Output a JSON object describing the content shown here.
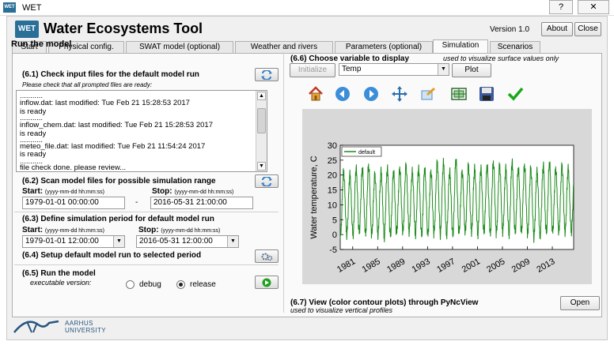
{
  "window": {
    "logo_text": "WET",
    "title": "WET",
    "help_label": "?",
    "close_label": "✕"
  },
  "header": {
    "logo_text": "WET",
    "title": "Water Ecosystems Tool",
    "version": "Version 1.0",
    "about_label": "About",
    "close_label": "Close"
  },
  "tabs": [
    {
      "label": "Start"
    },
    {
      "label": "Physical config."
    },
    {
      "label": "SWAT model (optional)"
    },
    {
      "label": "Weather and rivers"
    },
    {
      "label": "Parameters (optional)"
    },
    {
      "label": "Simulation"
    },
    {
      "label": "Scenarios"
    }
  ],
  "active_tab": "Simulation",
  "left": {
    "heading": "Run the model",
    "s61": {
      "title": "(6.1) Check input files for the default model run",
      "note": "Please check that all prompted files are ready:",
      "log": [
        "...........",
        "inflow.dat: last modified: Tue Feb 21 15:28:53 2017",
        "is ready",
        "...........",
        "inflow_chem.dat: last modified: Tue Feb 21 15:28:53 2017",
        "is ready",
        "...........",
        "meteo_file.dat: last modified: Tue Feb 21 11:54:24 2017",
        "is ready",
        "...........",
        "file check done. please review..."
      ]
    },
    "s62": {
      "title": "(6.2) Scan model files for possible simulation range",
      "start_label": "Start:",
      "start_format": "(yyyy-mm-dd hh:mm:ss)",
      "stop_label": "Stop:",
      "stop_format": "(yyyy-mm-dd hh:mm:ss)",
      "start_value": "1979-01-01 00:00:00",
      "dash": "-",
      "stop_value": "2016-05-31 21:00:00"
    },
    "s63": {
      "title": "(6.3) Define simulation period for default model run",
      "start_label": "Start:",
      "start_format": "(yyyy-mm-dd hh:mm:ss)",
      "stop_label": "Stop:",
      "stop_format": "(yyyy-mm-dd hh:mm:ss)",
      "start_value": "1979-01-01 12:00:00",
      "stop_value": "2016-05-31 12:00:00"
    },
    "s64": {
      "title": "(6.4) Setup default model run to selected period"
    },
    "s65": {
      "title": "(6.5) Run the model",
      "exec_label": "executable version:",
      "opt_debug": "debug",
      "opt_release": "release",
      "selected": "release"
    }
  },
  "right": {
    "s66": {
      "title": "(6.6) Choose variable to display",
      "note": "used to visualize surface values only",
      "initialize_label": "Initialize",
      "variable": "Temp",
      "plot_label": "Plot"
    },
    "toolbar_icons": [
      "home-icon",
      "back-arrow-icon",
      "forward-arrow-icon",
      "pan-icon",
      "zoom-icon",
      "subplot-config-icon",
      "save-icon",
      "check-icon"
    ],
    "s67": {
      "title": "(6.7) View (color contour plots) through PyNcView",
      "note": "used to visualize vertical profiles",
      "open_label": "Open"
    }
  },
  "footer": {
    "line1": "AARHUS",
    "line2": "UNIVERSITY"
  },
  "colors": {
    "series": "#1a8a1a",
    "logo_blue": "#2a6f97",
    "plot_bg": "#d8d8d8"
  },
  "chart_data": {
    "type": "line",
    "ylabel": "Water temperature, C",
    "xlabel": "",
    "legend": [
      "default"
    ],
    "legend_position": "top-left",
    "x_ticks": [
      "1981",
      "1985",
      "1989",
      "1993",
      "1997",
      "2001",
      "2005",
      "2009",
      "2013"
    ],
    "y_ticks": [
      -5,
      0,
      5,
      10,
      15,
      20,
      25,
      30
    ],
    "xlim": [
      1979.0,
      2016.42
    ],
    "ylim": [
      -5,
      30
    ],
    "series": [
      {
        "name": "default",
        "description": "seasonal cycle, winter minimum ~0 C, summer maximum ~20-25 C each year",
        "years": [
          1979,
          1980,
          1981,
          1982,
          1983,
          1984,
          1985,
          1986,
          1987,
          1988,
          1989,
          1990,
          1991,
          1992,
          1993,
          1994,
          1995,
          1996,
          1997,
          1998,
          1999,
          2000,
          2001,
          2002,
          2003,
          2004,
          2005,
          2006,
          2007,
          2008,
          2009,
          2010,
          2011,
          2012,
          2013,
          2014,
          2015,
          2016
        ],
        "annual_max": [
          21,
          20,
          22,
          22,
          23,
          20,
          21,
          22,
          21,
          22,
          23,
          21,
          22,
          22,
          21,
          24,
          24,
          21,
          25,
          21,
          23,
          22,
          22,
          23,
          24,
          23,
          22,
          24,
          22,
          23,
          22,
          21,
          23,
          24,
          22,
          23,
          22,
          20
        ],
        "annual_min": [
          0,
          0,
          0,
          1,
          0,
          0,
          0,
          -1,
          0,
          1,
          1,
          1,
          0,
          0,
          0,
          1,
          0,
          0,
          0,
          1,
          1,
          1,
          0,
          1,
          0,
          1,
          1,
          0,
          1,
          1,
          0,
          -1,
          0,
          1,
          1,
          1,
          1,
          1
        ]
      }
    ]
  }
}
